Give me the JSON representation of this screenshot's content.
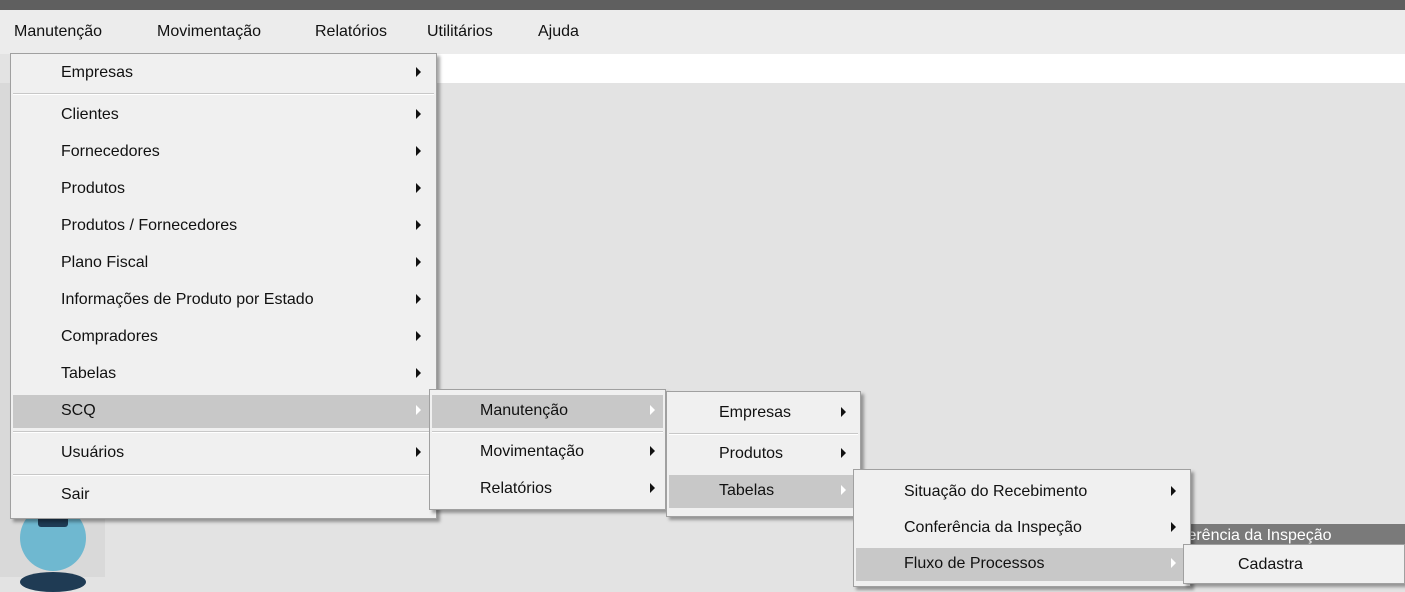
{
  "menubar": {
    "items": [
      "Manutenção",
      "Movimentação",
      "Relatórios",
      "Utilitários",
      "Ajuda"
    ]
  },
  "menu1": {
    "items": [
      "Empresas",
      "Clientes",
      "Fornecedores",
      "Produtos",
      "Produtos / Fornecedores",
      "Plano Fiscal",
      "Informações de Produto por Estado",
      "Compradores",
      "Tabelas",
      "SCQ",
      "Usuários",
      "Sair"
    ]
  },
  "menu2": {
    "items": [
      "Manutenção",
      "Movimentação",
      "Relatórios"
    ]
  },
  "menu3": {
    "items": [
      "Empresas",
      "Produtos",
      "Tabelas"
    ]
  },
  "menu4": {
    "items": [
      "Situação do Recebimento",
      "Conferência da Inspeção",
      "Fluxo de Processos"
    ]
  },
  "menu5": {
    "items": [
      "Cadastra"
    ]
  },
  "background": {
    "partial_label": "ferência da Inspeção"
  },
  "colors": {
    "highlight": "#c8c8c8",
    "menu_bg": "#f0f0f0",
    "app_bg": "#e3e3e3"
  }
}
